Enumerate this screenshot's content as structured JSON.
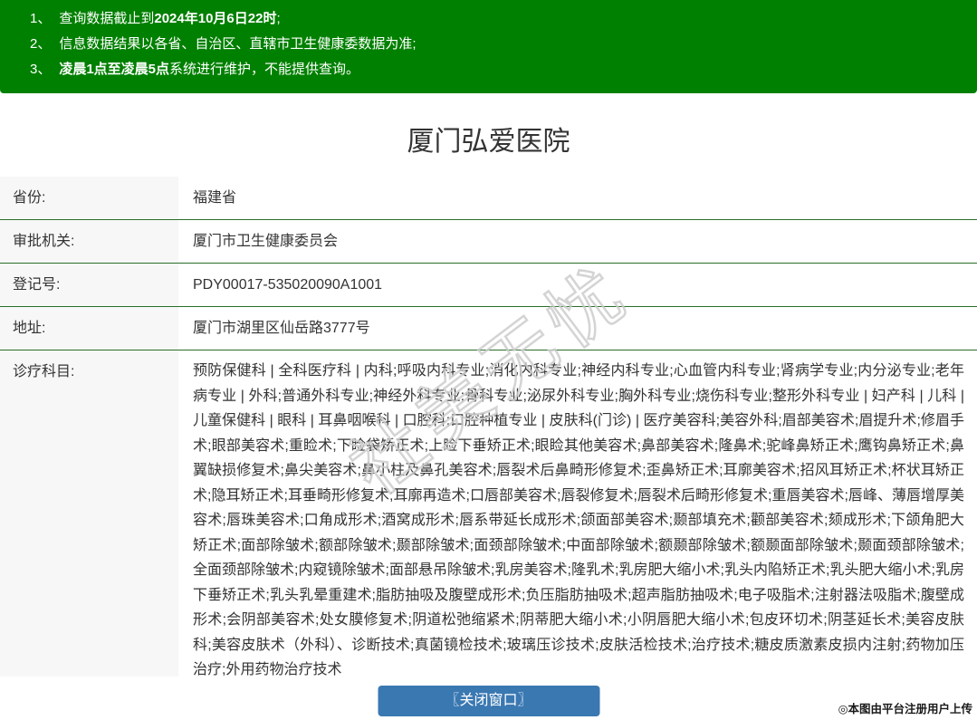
{
  "notice": {
    "items": [
      {
        "num": "1、",
        "pre": "查询数据截止到",
        "bold": "2024年10月6日22时",
        "post": ";"
      },
      {
        "num": "2、",
        "pre": "信息数据结果以各省、自治区、直辖市卫生健康委数据为准;",
        "bold": "",
        "post": ""
      },
      {
        "num": "3、",
        "pre": "",
        "bold": "凌晨1点至凌晨5点",
        "post": "系统进行维护，不能提供查询。"
      }
    ]
  },
  "page": {
    "title": "厦门弘爱医院"
  },
  "info": {
    "rows": [
      {
        "label": "省份:",
        "value": "福建省"
      },
      {
        "label": "审批机关:",
        "value": "厦门市卫生健康委员会"
      },
      {
        "label": "登记号:",
        "value": "PDY00017-535020090A1001"
      },
      {
        "label": "地址:",
        "value": "厦门市湖里区仙岳路3777号"
      },
      {
        "label": "诊疗科目:",
        "value": "预防保健科 | 全科医疗科 | 内科;呼吸内科专业;消化内科专业;神经内科专业;心血管内科专业;肾病学专业;内分泌专业;老年病专业 | 外科;普通外科专业;神经外科专业;骨科专业;泌尿外科专业;胸外科专业;烧伤科专业;整形外科专业 | 妇产科 | 儿科 | 儿童保健科 | 眼科 | 耳鼻咽喉科 | 口腔科;口腔种植专业 | 皮肤科(门诊) | 医疗美容科;美容外科;眉部美容术;眉提升术;修眉手术;眼部美容术;重睑术;下睑袋矫正术;上睑下垂矫正术;眼睑其他美容术;鼻部美容术;隆鼻术;驼峰鼻矫正术;鹰钩鼻矫正术;鼻翼缺损修复术;鼻尖美容术;鼻小柱及鼻孔美容术;唇裂术后鼻畸形修复术;歪鼻矫正术;耳廓美容术;招风耳矫正术;杯状耳矫正术;隐耳矫正术;耳垂畸形修复术;耳廓再造术;口唇部美容术;唇裂修复术;唇裂术后畸形修复术;重唇美容术;唇峰、薄唇增厚美容术;唇珠美容术;口角成形术;酒窝成形术;唇系带延长成形术;颌面部美容术;颞部填充术;颧部美容术;颏成形术;下颌角肥大矫正术;面部除皱术;额部除皱术;颞部除皱术;面颈部除皱术;中面部除皱术;额颞部除皱术;额颞面部除皱术;颞面颈部除皱术;全面颈部除皱术;内窥镜除皱术;面部悬吊除皱术;乳房美容术;隆乳术;乳房肥大缩小术;乳头内陷矫正术;乳头肥大缩小术;乳房下垂矫正术;乳头乳晕重建术;脂肪抽吸及腹壁成形术;负压脂肪抽吸术;超声脂肪抽吸术;电子吸脂术;注射器法吸脂术;腹壁成形术;会阴部美容术;处女膜修复术;阴道松弛缩紧术;阴蒂肥大缩小术;小阴唇肥大缩小术;包皮环切术;阴茎延长术;美容皮肤科;美容皮肤术（外科）、诊断技术;真菌镜检技术;玻璃压诊技术;皮肤活检技术;治疗技术;糖皮质激素皮损内注射;药物加压治疗;外用药物治疗技术"
      }
    ]
  },
  "footer": {
    "close_button_label": "〖关闭窗口〗"
  },
  "watermarks": {
    "diagonal": "社美无忧",
    "corner": "◎本图由平台注册用户上传"
  },
  "colors": {
    "banner_green": "#008000",
    "divider_green": "#2a6e2a",
    "button_blue": "#3a78b2",
    "label_bg": "#f7f7f7",
    "text": "#333333"
  }
}
